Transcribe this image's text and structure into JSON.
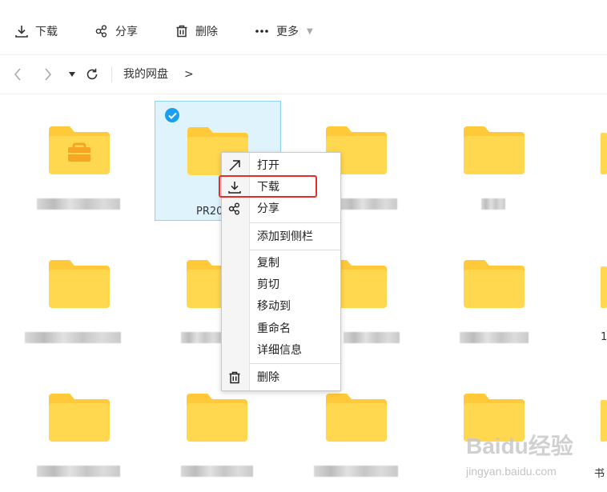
{
  "toolbar": {
    "download": "下载",
    "share": "分享",
    "delete": "删除",
    "more": "更多"
  },
  "navbar": {
    "breadcrumb": "我的网盘",
    "breadcrumb_arrow": ">"
  },
  "selected_tile_label": "PR20",
  "right_edge_labels": [
    "1",
    "书"
  ],
  "context_menu": {
    "open": "打开",
    "download": "下载",
    "share": "分享",
    "add_to_sidebar": "添加到侧栏",
    "copy": "复制",
    "cut": "剪切",
    "move_to": "移动到",
    "rename": "重命名",
    "details": "详细信息",
    "delete": "删除"
  },
  "watermark": {
    "logo": "Baidu经验",
    "sub": "jingyan.baidu.com"
  },
  "colors": {
    "folder": "#ffd84f",
    "folder_tab": "#ffc93a",
    "selection_bg": "#dff3fc",
    "check": "#1a9ff0",
    "highlight": "#e82c2c"
  },
  "icons": {
    "download": "download-icon",
    "share": "share-icon",
    "delete": "trash-icon",
    "more": "more-dots-icon",
    "open": "arrow-up-right-icon"
  }
}
